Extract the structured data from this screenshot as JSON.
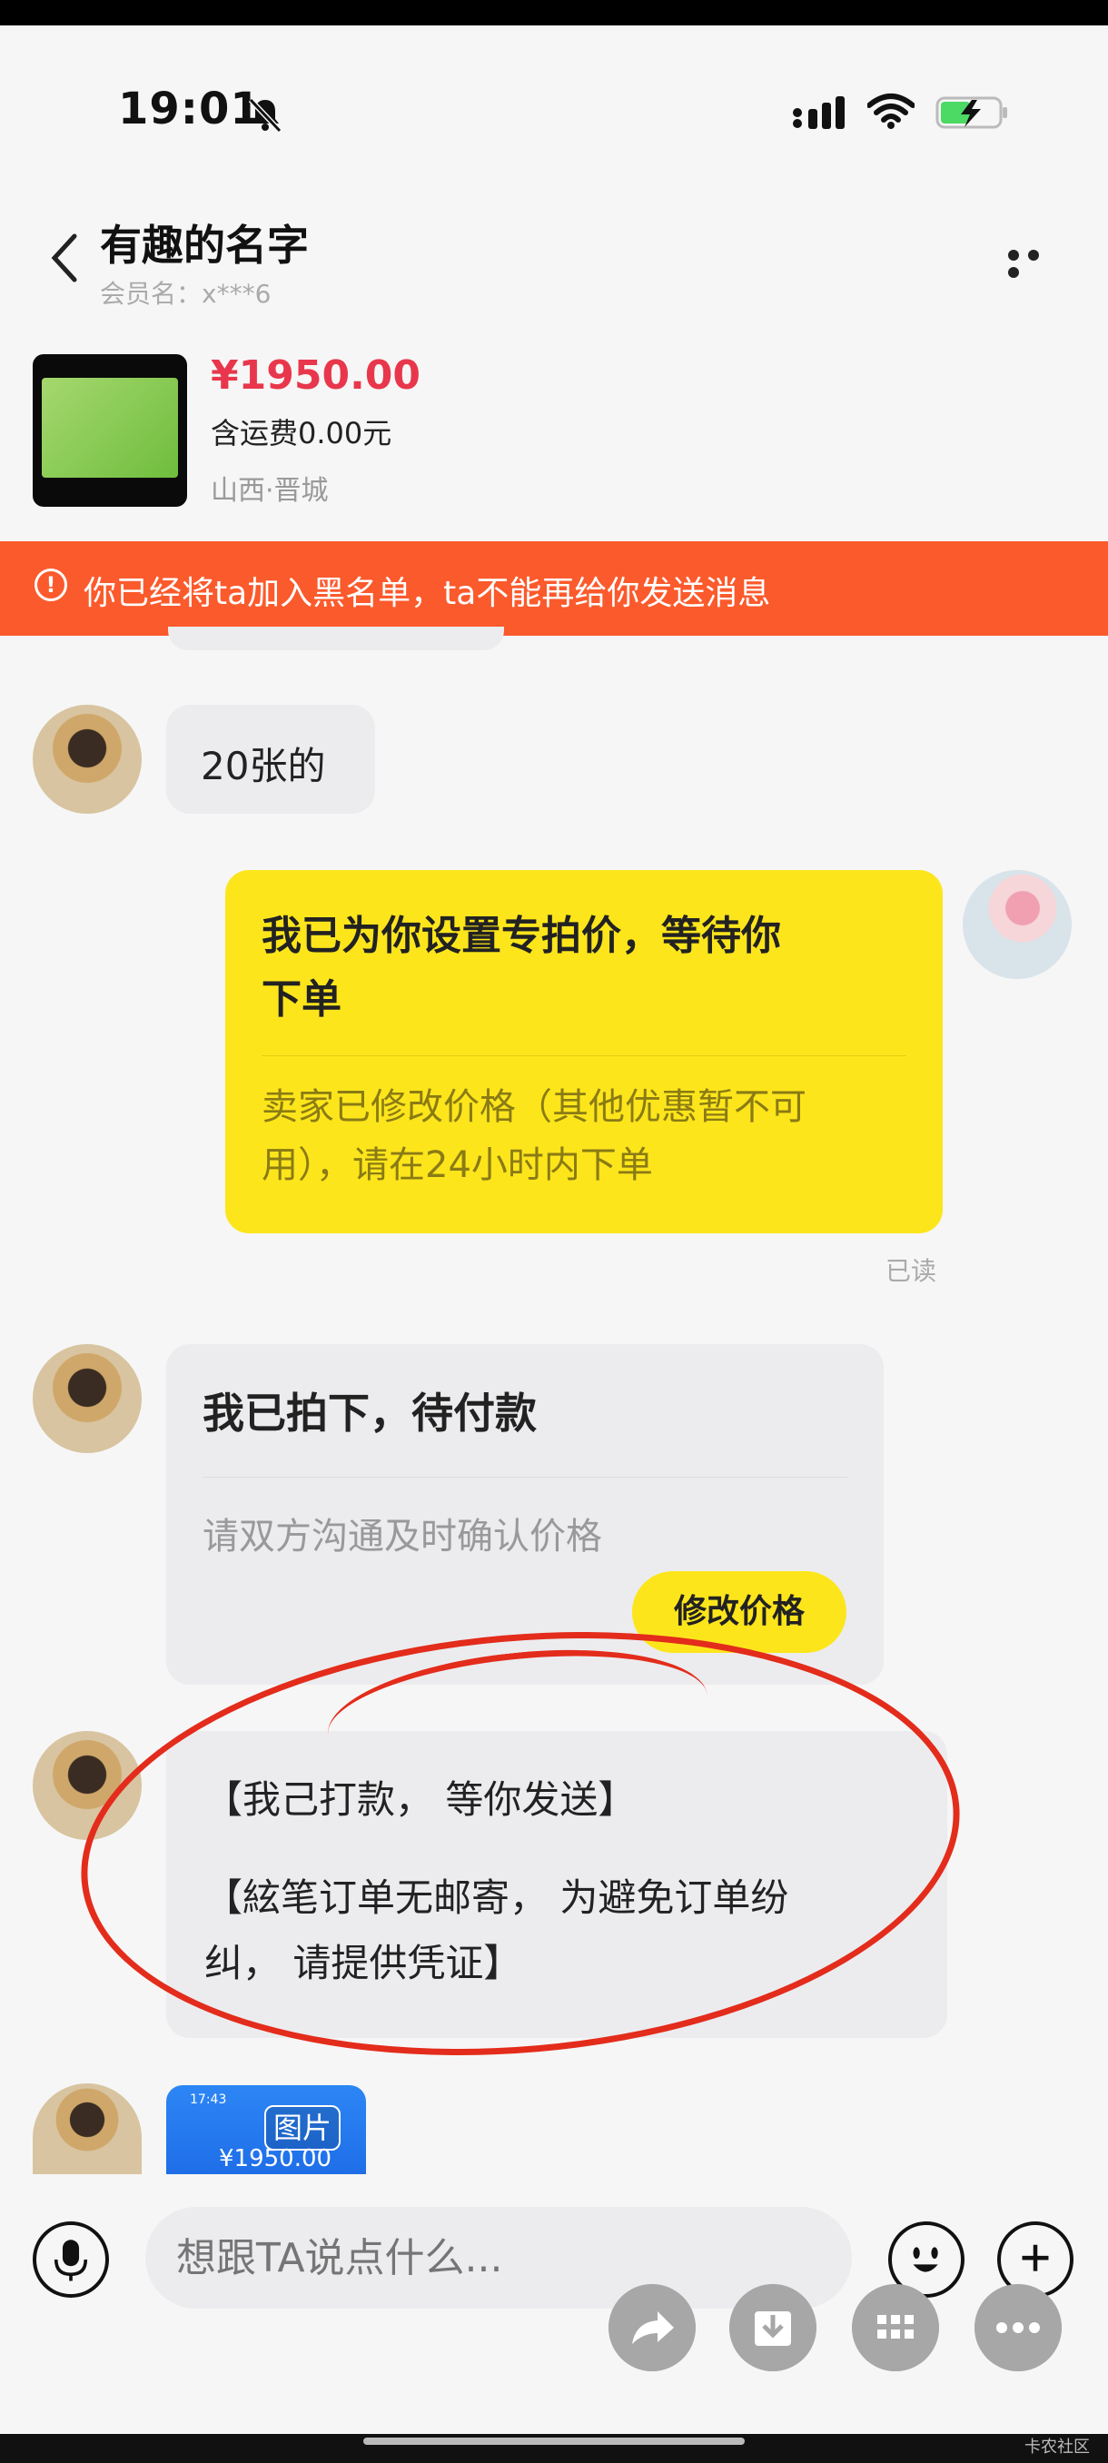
{
  "status_bar": {
    "time": "19:01"
  },
  "header": {
    "title": "有趣的名字",
    "member": "会员名：x***6"
  },
  "product": {
    "price": "¥1950.00",
    "shipping": "含运费0.00元",
    "location": "山西·晋城"
  },
  "banner": {
    "text": "你已经将ta加入黑名单，ta不能再给你发送消息"
  },
  "messages": {
    "m1": "20张的",
    "m2": {
      "title_line1": "我已为你设置专拍价，等待你",
      "title_line2": "下单",
      "desc_line1": "卖家已修改价格（其他优惠暂不可",
      "desc_line2": "用），请在24小时内下单",
      "status": "已读"
    },
    "m3": {
      "title": "我已拍下，待付款",
      "desc": "请双方沟通及时确认价格",
      "button": "修改价格"
    },
    "m4": {
      "line1": "【我己打款， 等你发送】",
      "line2": "【絃笔订单无邮寄， 为避免订单纷",
      "line3": "纠， 请提供凭证】"
    },
    "m5": {
      "tag": "图片",
      "amount": "¥1950.00",
      "time": "17:43"
    }
  },
  "input": {
    "placeholder": "想跟TA说点什么..."
  },
  "watermark": "卡农社区",
  "colors": {
    "accent_yellow": "#fde51c",
    "banner_orange": "#fb5a2c",
    "price_red": "#e8374c",
    "annotation_red": "#e32c1b"
  }
}
